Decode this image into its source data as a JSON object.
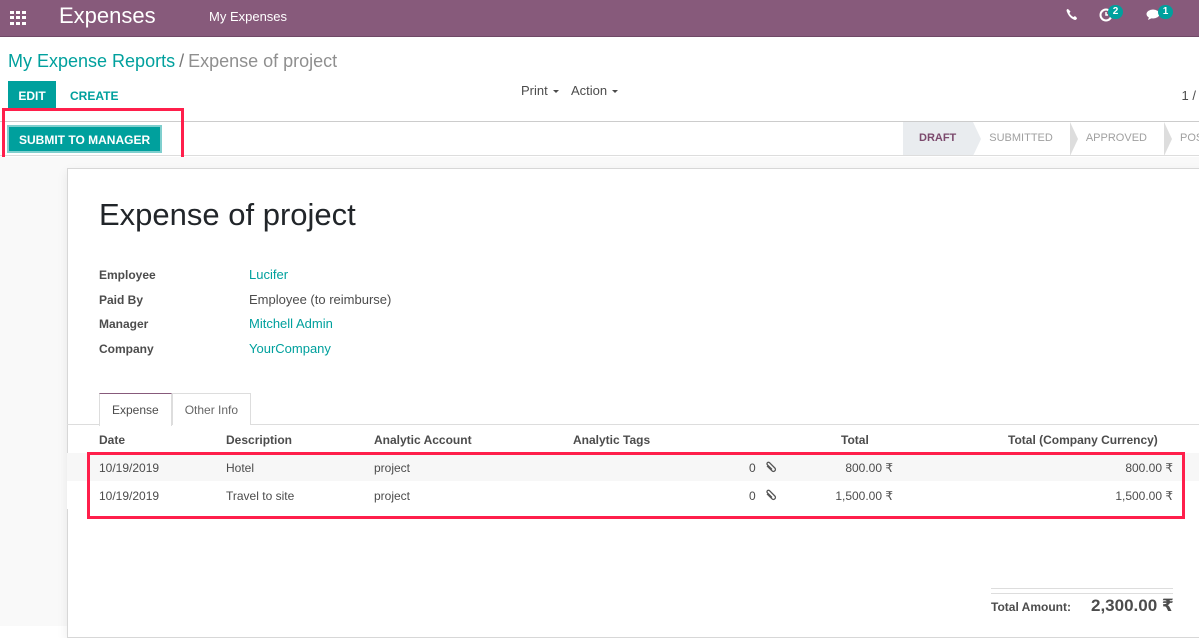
{
  "topbar": {
    "app_title": "Expenses",
    "menu_item": "My Expenses",
    "activity_badge": "2",
    "messages_badge": "1",
    "icons": [
      "apps-grid-icon",
      "phone-icon",
      "activity-clock-icon",
      "chat-icon"
    ]
  },
  "breadcrumb": {
    "parent": "My Expense Reports",
    "separator": "/",
    "current": "Expense of project"
  },
  "toolbar": {
    "edit_label": "EDIT",
    "create_label": "CREATE",
    "print_label": "Print",
    "action_label": "Action",
    "pager": "1 /"
  },
  "statusbar": {
    "submit_label": "SUBMIT TO MANAGER",
    "stages": [
      {
        "label": "DRAFT",
        "active": true
      },
      {
        "label": "SUBMITTED",
        "active": false
      },
      {
        "label": "APPROVED",
        "active": false
      },
      {
        "label": "POSTED",
        "active": false
      }
    ]
  },
  "form": {
    "title": "Expense of project",
    "fields": [
      {
        "label": "Employee",
        "value": "Lucifer",
        "link": true
      },
      {
        "label": "Paid By",
        "value": "Employee (to reimburse)",
        "link": false
      },
      {
        "label": "Manager",
        "value": "Mitchell Admin",
        "link": true
      },
      {
        "label": "Company",
        "value": "YourCompany",
        "link": true
      }
    ]
  },
  "tabs": [
    {
      "label": "Expense",
      "active": true
    },
    {
      "label": "Other Info",
      "active": false
    }
  ],
  "table": {
    "columns": [
      "Date",
      "Description",
      "Analytic Account",
      "Analytic Tags",
      "Total",
      "Total (Company Currency)"
    ],
    "rows": [
      {
        "date": "10/19/2019",
        "description": "Hotel",
        "analytic_account": "project",
        "attachments": "0",
        "total": "800.00 ₹",
        "total_company": "800.00 ₹"
      },
      {
        "date": "10/19/2019",
        "description": "Travel to site",
        "analytic_account": "project",
        "attachments": "0",
        "total": "1,500.00 ₹",
        "total_company": "1,500.00 ₹"
      }
    ]
  },
  "totals": {
    "label": "Total Amount:",
    "value": "2,300.00 ₹"
  },
  "colors": {
    "brand": "#875a7b",
    "accent": "#00a09d",
    "highlight": "#ff1f4b"
  }
}
